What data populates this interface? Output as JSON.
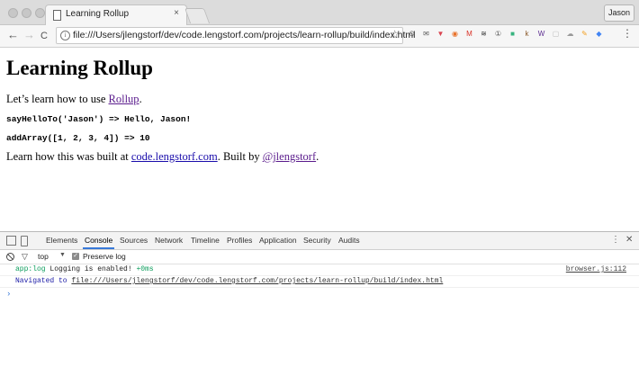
{
  "browser": {
    "tab_title": "Learning Rollup",
    "tab_close": "×",
    "profile_name": "Jason",
    "url": "file:///Users/jlengstorf/dev/code.lengstorf.com/projects/learn-rollup/build/index.html",
    "nav": {
      "back": "←",
      "forward": "→",
      "reload": "C"
    },
    "star": "☆",
    "menu": "⋮",
    "extensions": [
      {
        "name": "alarm-icon",
        "glyph": "⏲",
        "color": "#555555"
      },
      {
        "name": "mail-icon",
        "glyph": "✉",
        "color": "#555555"
      },
      {
        "name": "pocket-icon",
        "glyph": "▼",
        "color": "#d9434f"
      },
      {
        "name": "rss-icon",
        "glyph": "◉",
        "color": "#e8712a"
      },
      {
        "name": "gmail-icon",
        "glyph": "M",
        "color": "#d93025"
      },
      {
        "name": "buffer-icon",
        "glyph": "≋",
        "color": "#333333"
      },
      {
        "name": "onepassword-icon",
        "glyph": "①",
        "color": "#555555"
      },
      {
        "name": "green-ext-icon",
        "glyph": "■",
        "color": "#36b37e"
      },
      {
        "name": "k-ext-icon",
        "glyph": "k",
        "color": "#8b5a2b"
      },
      {
        "name": "purple-ext-icon",
        "glyph": "W",
        "color": "#5c2d91"
      },
      {
        "name": "gray-ext-icon",
        "glyph": "▢",
        "color": "#bbbbbb"
      },
      {
        "name": "cloud-ext-icon",
        "glyph": "☁",
        "color": "#999999"
      },
      {
        "name": "orange-ext-icon",
        "glyph": "✎",
        "color": "#f4a023"
      },
      {
        "name": "colorful-ext-icon",
        "glyph": "◆",
        "color": "#4285f4"
      }
    ]
  },
  "page": {
    "heading": "Learning Rollup",
    "intro_prefix": "Let’s learn how to use ",
    "intro_link": "Rollup",
    "intro_suffix": ".",
    "code_line_1": "sayHelloTo('Jason') => Hello, Jason!",
    "code_line_2": "addArray([1, 2, 3, 4]) => 10",
    "built_prefix": "Learn how this was built at ",
    "built_link": "code.lengstorf.com",
    "built_mid": ". Built by ",
    "author_link": "@jlengstorf",
    "built_suffix": "."
  },
  "devtools": {
    "tabs": [
      "Elements",
      "Console",
      "Sources",
      "Network",
      "Timeline",
      "Profiles",
      "Application",
      "Security",
      "Audits"
    ],
    "active_tab": "Console",
    "context": "top",
    "preserve_log_label": "Preserve log",
    "preserve_log_checked": true,
    "more_icon": "⋮",
    "close_icon": "✕",
    "logs": [
      {
        "prefix": "app:log",
        "message": " Logging is enabled! ",
        "suffix": "+0ms",
        "source": "browser.js:112"
      },
      {
        "prefix": "Navigated to ",
        "url": "file:///Users/jlengstorf/dev/code.lengstorf.com/projects/learn-rollup/build/index.html"
      }
    ],
    "prompt": "›"
  },
  "colors": {
    "accent": "#3879d9",
    "link": "#1a0dab",
    "visited_link": "#5a1b8c",
    "log_green": "#0a9c5b",
    "log_navy": "#1a1aa6"
  }
}
